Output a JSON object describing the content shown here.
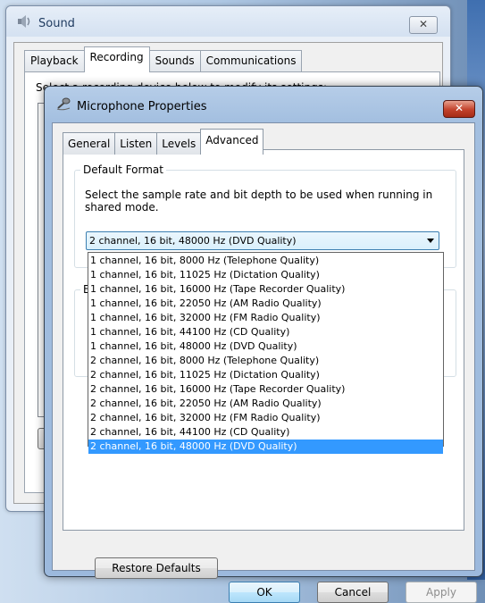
{
  "sound_window": {
    "title": "Sound",
    "close_glyph": "✕",
    "tabs": [
      "Playback",
      "Recording",
      "Sounds",
      "Communications"
    ],
    "active_tab": "Recording",
    "panel_text": "Select a recording device below to modify its settings:"
  },
  "dialog": {
    "title": "Microphone Properties",
    "close_glyph": "✕",
    "tabs": [
      "General",
      "Listen",
      "Levels",
      "Advanced"
    ],
    "active_tab": "Advanced",
    "default_format": {
      "legend": "Default Format",
      "description": "Select the sample rate and bit depth to be used when running in shared mode.",
      "selected": "2 channel, 16 bit, 48000 Hz (DVD Quality)"
    },
    "exclusive_mode": {
      "legend": "E"
    },
    "options": [
      "1 channel, 16 bit, 8000 Hz (Telephone Quality)",
      "1 channel, 16 bit, 11025 Hz (Dictation Quality)",
      "1 channel, 16 bit, 16000 Hz (Tape Recorder Quality)",
      "1 channel, 16 bit, 22050 Hz (AM Radio Quality)",
      "1 channel, 16 bit, 32000 Hz (FM Radio Quality)",
      "1 channel, 16 bit, 44100 Hz (CD Quality)",
      "1 channel, 16 bit, 48000 Hz (DVD Quality)",
      "2 channel, 16 bit, 8000 Hz (Telephone Quality)",
      "2 channel, 16 bit, 11025 Hz (Dictation Quality)",
      "2 channel, 16 bit, 16000 Hz (Tape Recorder Quality)",
      "2 channel, 16 bit, 22050 Hz (AM Radio Quality)",
      "2 channel, 16 bit, 32000 Hz (FM Radio Quality)",
      "2 channel, 16 bit, 44100 Hz (CD Quality)",
      "2 channel, 16 bit, 48000 Hz (DVD Quality)"
    ],
    "selected_option_index": 13,
    "restore_label": "Restore Defaults",
    "ok_label": "OK",
    "cancel_label": "Cancel",
    "apply_label": "Apply"
  },
  "colors": {
    "selection": "#3399ff",
    "close_red": "#c2412b",
    "dialog_frame": "#a3bfe0"
  }
}
